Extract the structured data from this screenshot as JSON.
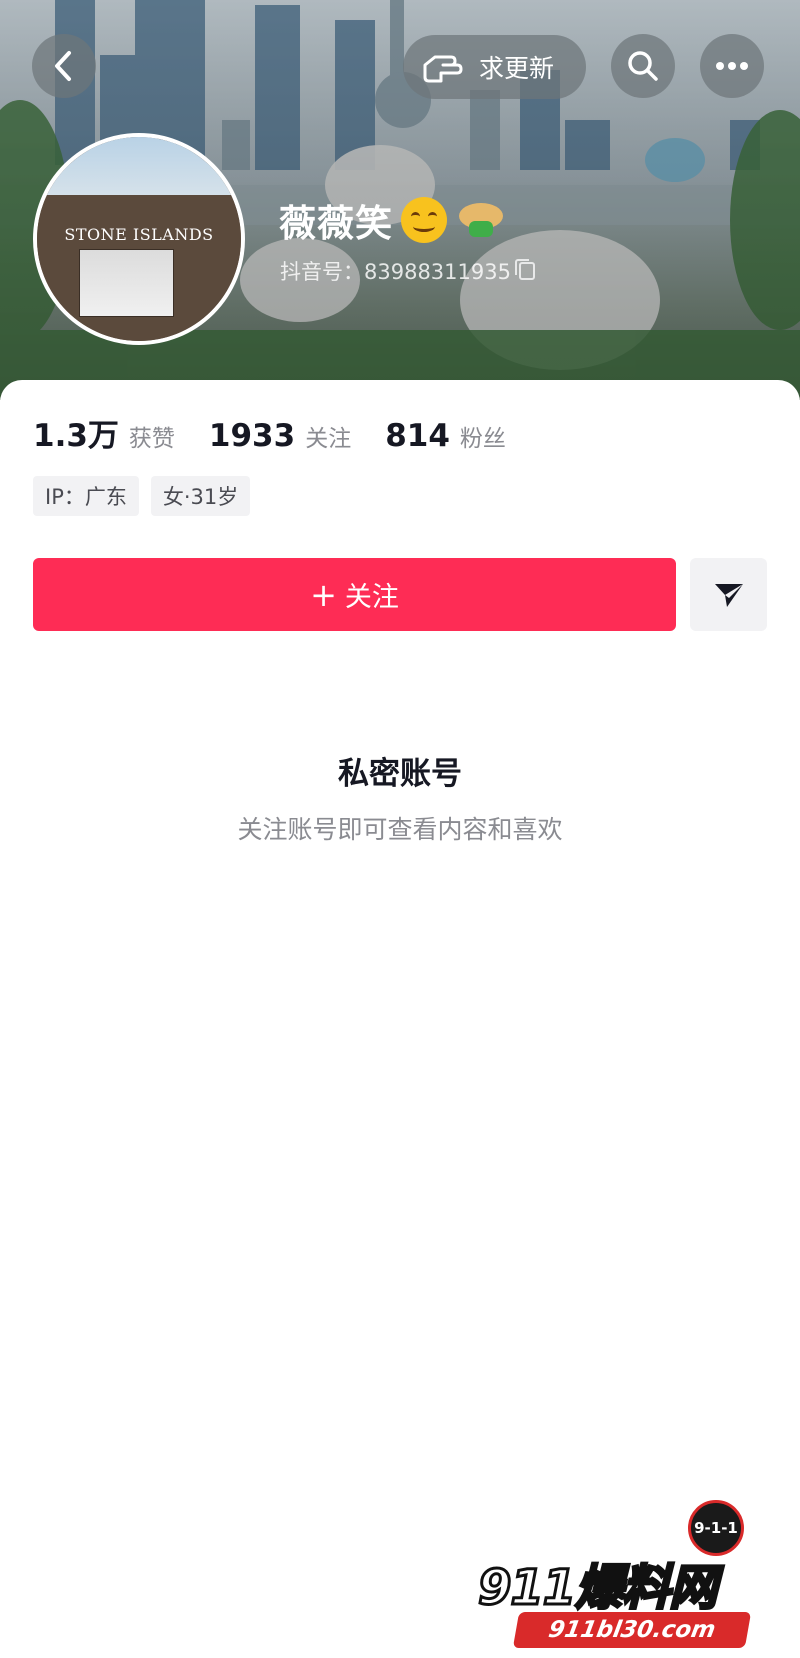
{
  "header": {
    "back_icon": "chevron-left-icon",
    "update_label": "求更新",
    "update_icon": "pointing-hand-icon",
    "search_icon": "search-icon",
    "more_icon": "more-dots-icon"
  },
  "profile": {
    "avatar_text": "STONE ISLANDS",
    "name": "薇薇笑",
    "name_emojis": [
      "smile-emoji",
      "hat-bow-emoji"
    ],
    "douyin_id": "抖音号：83988311935",
    "copy_icon": "copy-icon"
  },
  "stats": [
    {
      "num": "1.3万",
      "label": "获赞"
    },
    {
      "num": "1933",
      "label": "关注"
    },
    {
      "num": "814",
      "label": "粉丝"
    }
  ],
  "tags": [
    "IP：广东",
    "女·31岁"
  ],
  "actions": {
    "follow_plus": "+",
    "follow_label": "关注",
    "share_icon": "send-icon"
  },
  "private": {
    "title": "私密账号",
    "subtitle": "关注账号即可查看内容和喜欢"
  },
  "watermark": {
    "badge": "9-1-1",
    "main": "911爆料网",
    "url": "911bl30.com"
  },
  "colors": {
    "primary": "#fe2c55",
    "text_dark": "#161823",
    "text_gray": "#8a8b91",
    "tag_bg": "#f2f2f4"
  }
}
